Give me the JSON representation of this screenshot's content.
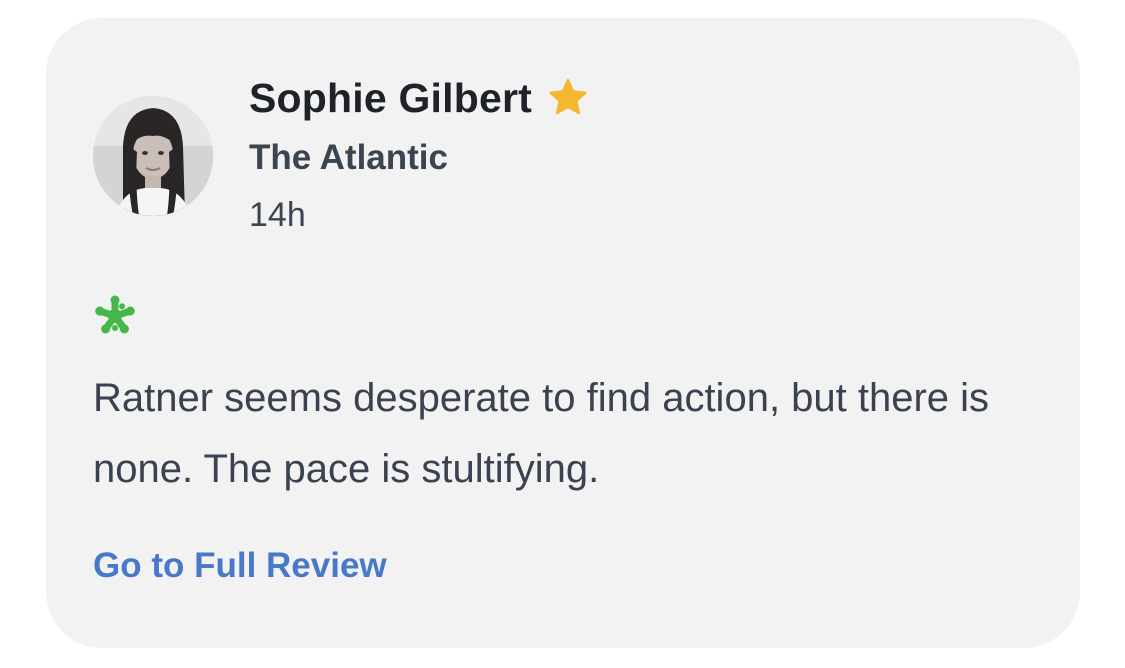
{
  "review": {
    "critic_name": "Sophie Gilbert",
    "top_critic_icon": "star-icon",
    "publication": "The Atlantic",
    "timestamp": "14h",
    "rating_icon": "rotten-splat-icon",
    "quote": "Ratner seems desperate to find action, but there is none. The pace is stultifying.",
    "link_label": "Go to Full Review"
  },
  "colors": {
    "card_background": "#f2f2f2",
    "star": "#f5b72d",
    "splat": "#45b64a",
    "link": "#4a78c8",
    "name_text": "#1f2329",
    "body_text": "#3a4150"
  }
}
